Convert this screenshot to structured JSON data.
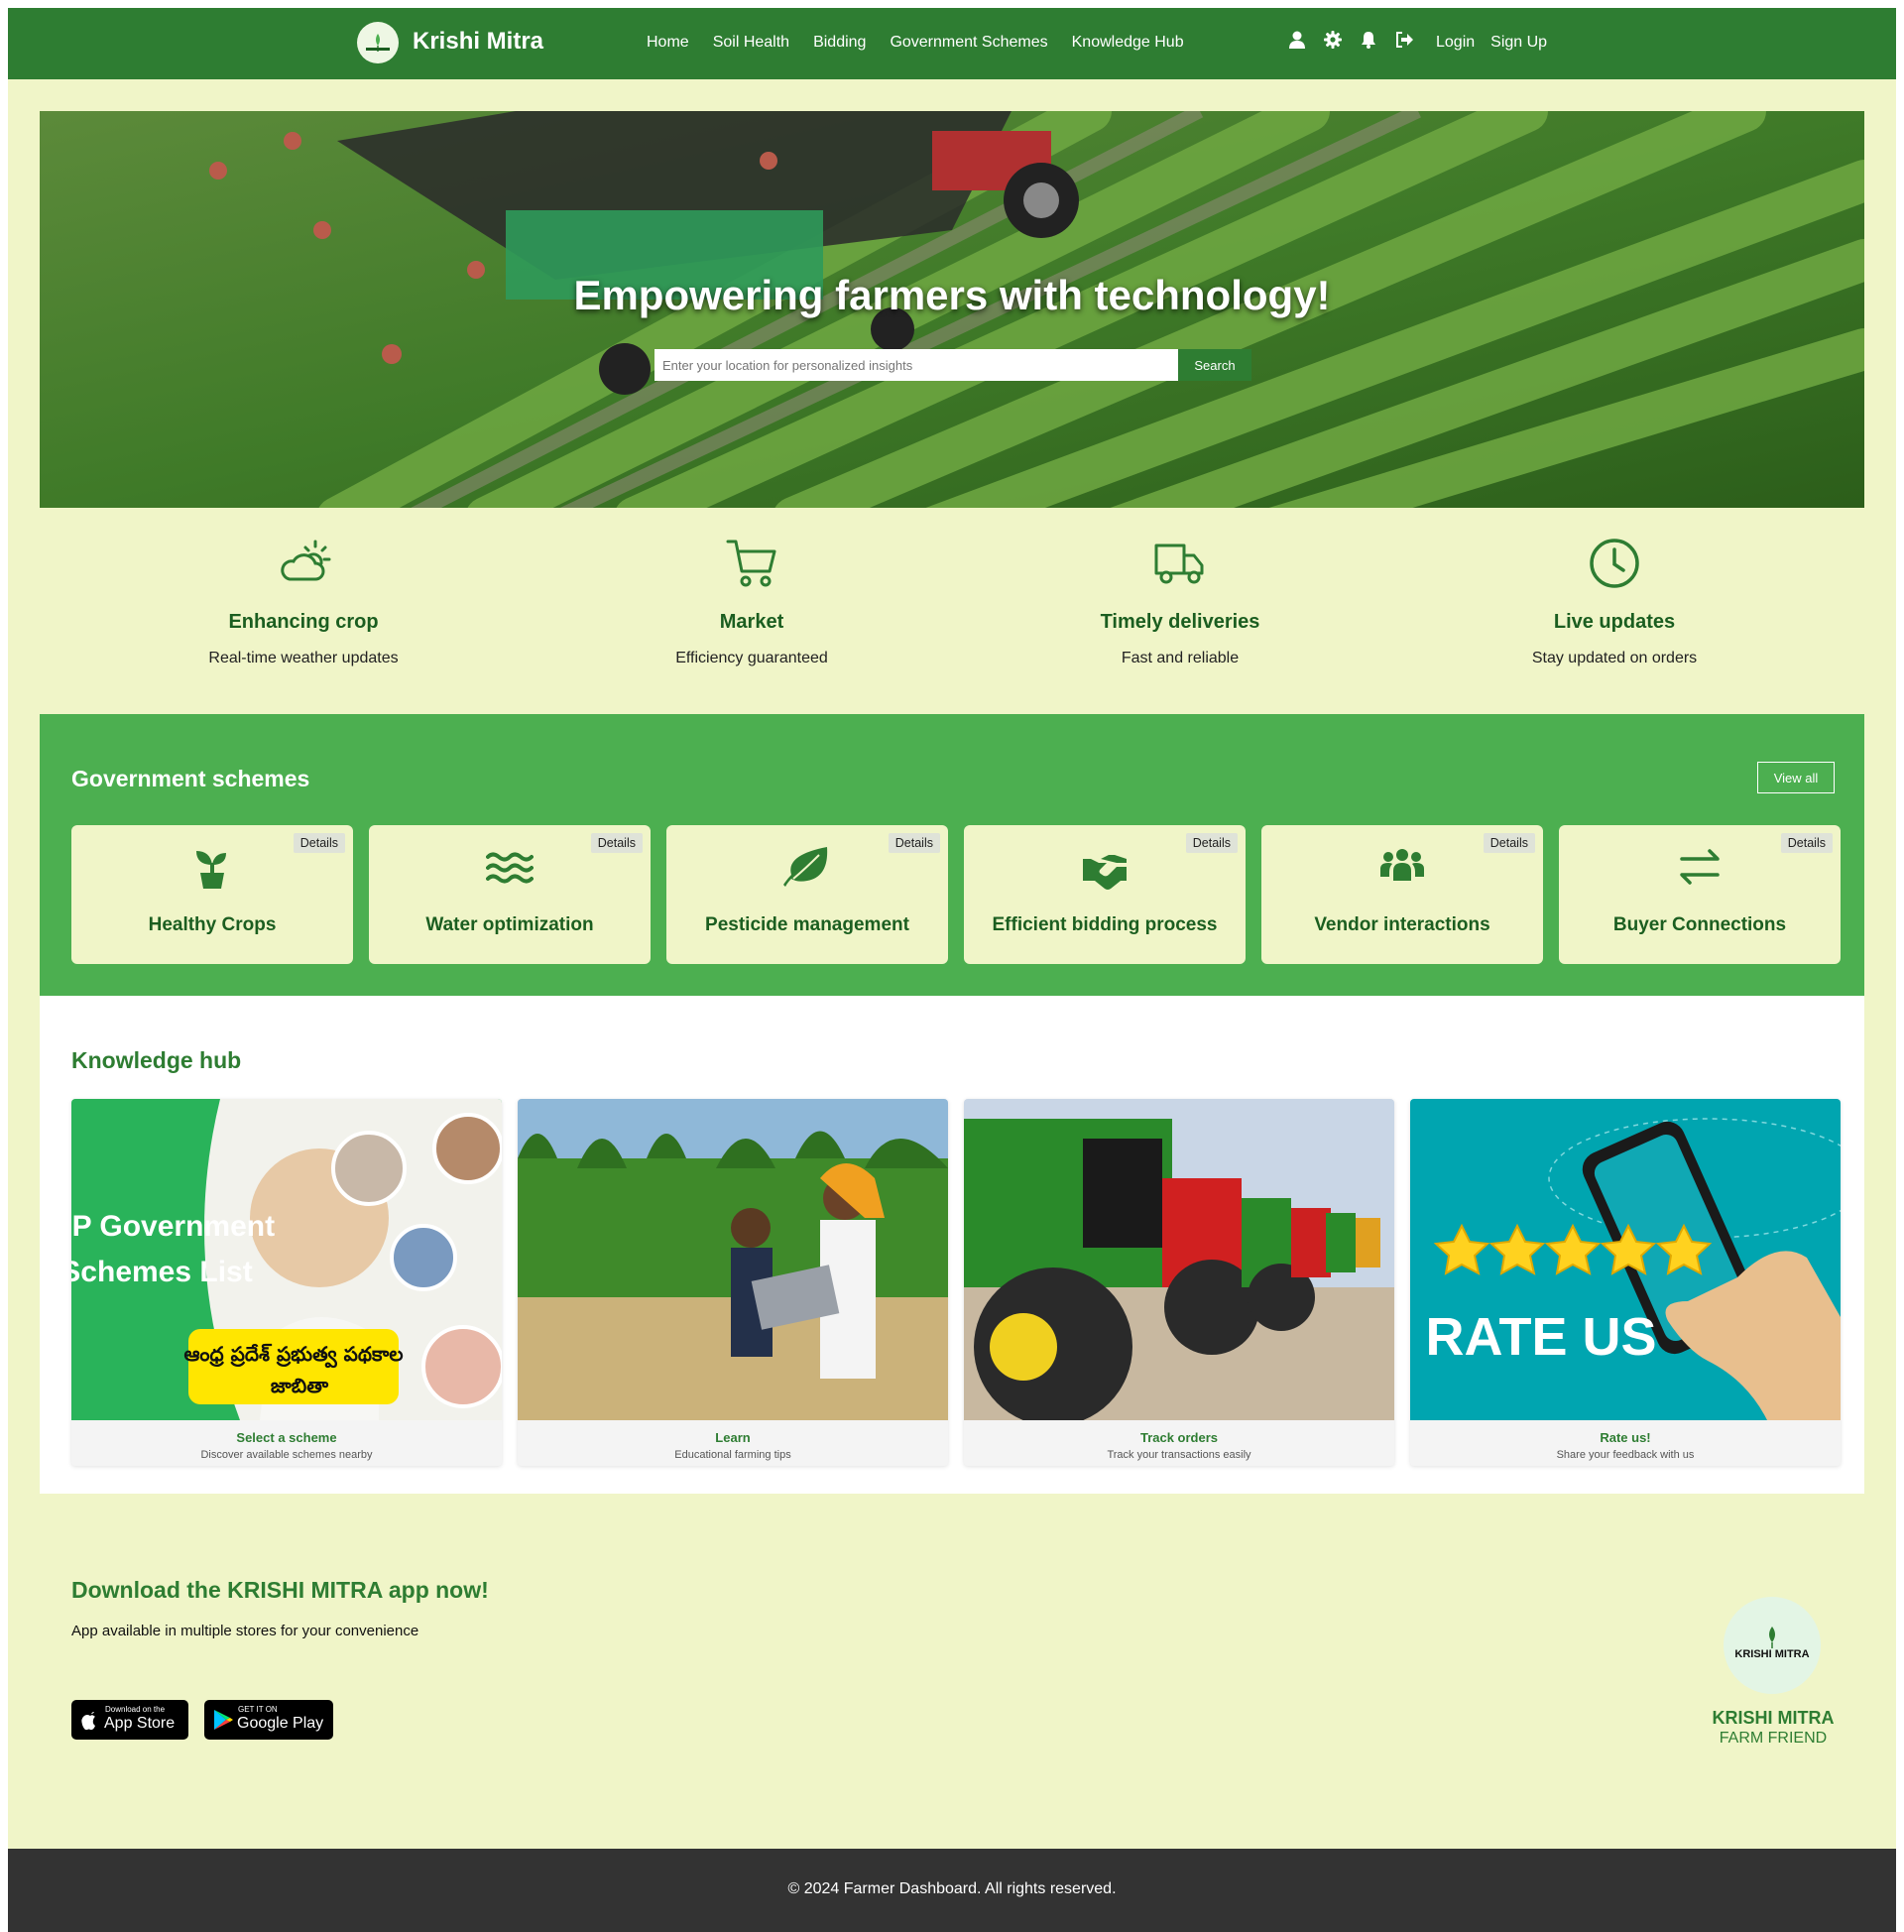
{
  "header": {
    "brand": "Krishi Mitra",
    "nav": [
      "Home",
      "Soil Health",
      "Bidding",
      "Government Schemes",
      "Knowledge Hub"
    ],
    "icons": [
      "user-icon",
      "gear-icon",
      "bell-icon",
      "logout-icon"
    ],
    "login": "Login",
    "signup": "Sign Up"
  },
  "hero": {
    "title": "Empowering farmers with technology!",
    "search_placeholder": "Enter your location for personalized insights",
    "search_button": "Search"
  },
  "features": [
    {
      "icon": "cloud-sun-icon",
      "title": "Enhancing crop",
      "subtitle": "Real-time weather updates"
    },
    {
      "icon": "shopping-cart-icon",
      "title": "Market",
      "subtitle": "Efficiency guaranteed"
    },
    {
      "icon": "truck-icon",
      "title": "Timely deliveries",
      "subtitle": "Fast and reliable"
    },
    {
      "icon": "clock-icon",
      "title": "Live updates",
      "subtitle": "Stay updated on orders"
    }
  ],
  "schemes": {
    "title": "Government schemes",
    "view_all": "View all",
    "details_label": "Details",
    "items": [
      {
        "icon": "seedling-icon",
        "label": "Healthy Crops"
      },
      {
        "icon": "water-icon",
        "label": "Water optimization"
      },
      {
        "icon": "leaf-icon",
        "label": "Pesticide management"
      },
      {
        "icon": "handshake-icon",
        "label": "Efficient bidding process"
      },
      {
        "icon": "people-group-icon",
        "label": "Vendor interactions"
      },
      {
        "icon": "exchange-arrows-icon",
        "label": "Buyer Connections"
      }
    ]
  },
  "knowledge_hub": {
    "title": "Knowledge hub",
    "cards": [
      {
        "title": "Select a scheme",
        "subtitle": "Discover available schemes nearby",
        "image_text": [
          "AP Government",
          "Schemes List",
          "ఆంధ్ర ప్రదేశ్ ప్రభుత్వ పథకాల",
          "జాబితా"
        ]
      },
      {
        "title": "Learn",
        "subtitle": "Educational farming tips"
      },
      {
        "title": "Track orders",
        "subtitle": "Track your transactions easily"
      },
      {
        "title": "Rate us!",
        "subtitle": "Share your feedback with us",
        "image_text": [
          "RATE US"
        ]
      }
    ]
  },
  "download": {
    "title": "Download the KRISHI MITRA app now!",
    "subtitle": "App available in multiple stores for your convenience",
    "app_store_small": "Download on the",
    "app_store": "App Store",
    "google_play_small": "GET IT ON",
    "google_play": "Google Play",
    "logo_text": "KRISHI MITRA",
    "brand": "KRISHI MITRA",
    "tagline": "FARM FRIEND"
  },
  "footer": {
    "copyright": "© 2024 Farmer Dashboard. All rights reserved."
  },
  "colors": {
    "header_green": "#2e7d32",
    "scheme_band_green": "#4caf50",
    "page_background": "#f0f5c8",
    "footer_dark": "#333333"
  }
}
